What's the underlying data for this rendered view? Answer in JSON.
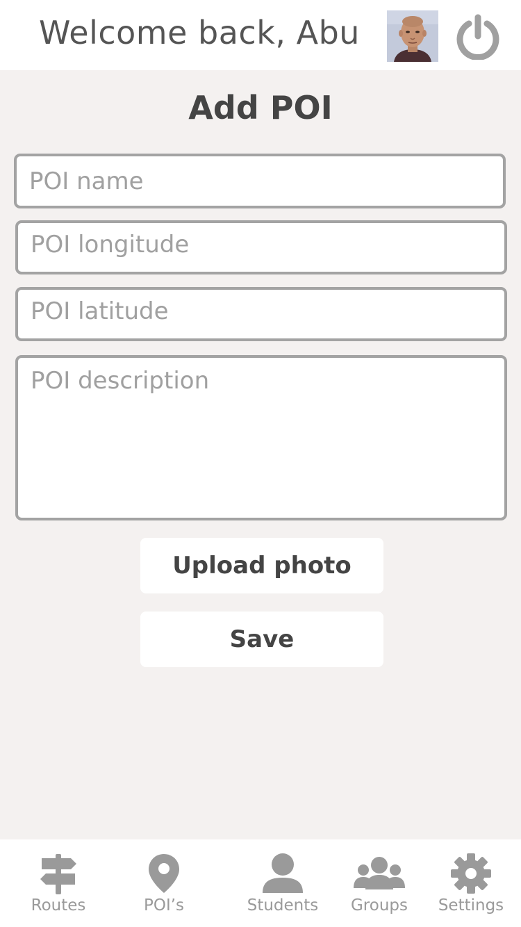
{
  "header": {
    "welcome": "Welcome back, Abu",
    "avatar_icon": "user-photo",
    "power_icon": "power-icon"
  },
  "page": {
    "title": "Add POI"
  },
  "form": {
    "name_placeholder": "POI name",
    "longitude_placeholder": "POI longitude",
    "latitude_placeholder": "POI latitude",
    "description_placeholder": "POI description",
    "upload_label": "Upload photo",
    "save_label": "Save"
  },
  "nav": {
    "items": [
      {
        "label": "Routes",
        "icon": "signpost-icon"
      },
      {
        "label": "POI’s",
        "icon": "map-pin-icon"
      },
      {
        "label": "Students",
        "icon": "user-icon"
      },
      {
        "label": "Groups",
        "icon": "group-icon"
      },
      {
        "label": "Settings",
        "icon": "gear-icon"
      }
    ]
  },
  "colors": {
    "background": "#f4f1f0",
    "text_dark": "#444444",
    "icon_gray": "#9a9a9a",
    "border_gray": "#a3a3a3"
  }
}
